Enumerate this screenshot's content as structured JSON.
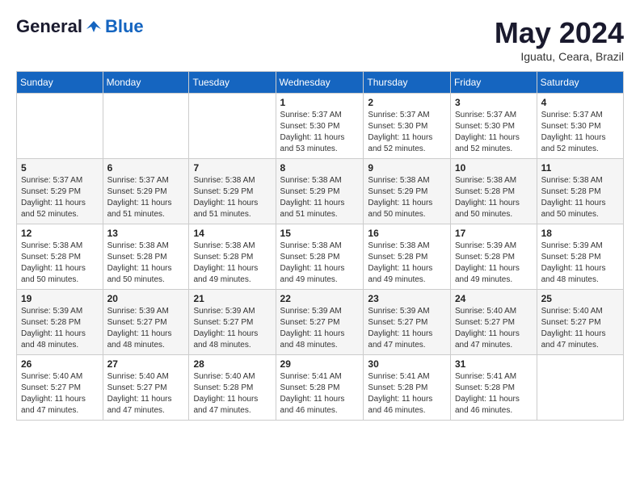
{
  "header": {
    "logo_general": "General",
    "logo_blue": "Blue",
    "month_title": "May 2024",
    "location": "Iguatu, Ceara, Brazil"
  },
  "days_of_week": [
    "Sunday",
    "Monday",
    "Tuesday",
    "Wednesday",
    "Thursday",
    "Friday",
    "Saturday"
  ],
  "weeks": [
    [
      {
        "day": "",
        "info": ""
      },
      {
        "day": "",
        "info": ""
      },
      {
        "day": "",
        "info": ""
      },
      {
        "day": "1",
        "info": "Sunrise: 5:37 AM\nSunset: 5:30 PM\nDaylight: 11 hours\nand 53 minutes."
      },
      {
        "day": "2",
        "info": "Sunrise: 5:37 AM\nSunset: 5:30 PM\nDaylight: 11 hours\nand 52 minutes."
      },
      {
        "day": "3",
        "info": "Sunrise: 5:37 AM\nSunset: 5:30 PM\nDaylight: 11 hours\nand 52 minutes."
      },
      {
        "day": "4",
        "info": "Sunrise: 5:37 AM\nSunset: 5:30 PM\nDaylight: 11 hours\nand 52 minutes."
      }
    ],
    [
      {
        "day": "5",
        "info": "Sunrise: 5:37 AM\nSunset: 5:29 PM\nDaylight: 11 hours\nand 52 minutes."
      },
      {
        "day": "6",
        "info": "Sunrise: 5:37 AM\nSunset: 5:29 PM\nDaylight: 11 hours\nand 51 minutes."
      },
      {
        "day": "7",
        "info": "Sunrise: 5:38 AM\nSunset: 5:29 PM\nDaylight: 11 hours\nand 51 minutes."
      },
      {
        "day": "8",
        "info": "Sunrise: 5:38 AM\nSunset: 5:29 PM\nDaylight: 11 hours\nand 51 minutes."
      },
      {
        "day": "9",
        "info": "Sunrise: 5:38 AM\nSunset: 5:29 PM\nDaylight: 11 hours\nand 50 minutes."
      },
      {
        "day": "10",
        "info": "Sunrise: 5:38 AM\nSunset: 5:28 PM\nDaylight: 11 hours\nand 50 minutes."
      },
      {
        "day": "11",
        "info": "Sunrise: 5:38 AM\nSunset: 5:28 PM\nDaylight: 11 hours\nand 50 minutes."
      }
    ],
    [
      {
        "day": "12",
        "info": "Sunrise: 5:38 AM\nSunset: 5:28 PM\nDaylight: 11 hours\nand 50 minutes."
      },
      {
        "day": "13",
        "info": "Sunrise: 5:38 AM\nSunset: 5:28 PM\nDaylight: 11 hours\nand 50 minutes."
      },
      {
        "day": "14",
        "info": "Sunrise: 5:38 AM\nSunset: 5:28 PM\nDaylight: 11 hours\nand 49 minutes."
      },
      {
        "day": "15",
        "info": "Sunrise: 5:38 AM\nSunset: 5:28 PM\nDaylight: 11 hours\nand 49 minutes."
      },
      {
        "day": "16",
        "info": "Sunrise: 5:38 AM\nSunset: 5:28 PM\nDaylight: 11 hours\nand 49 minutes."
      },
      {
        "day": "17",
        "info": "Sunrise: 5:39 AM\nSunset: 5:28 PM\nDaylight: 11 hours\nand 49 minutes."
      },
      {
        "day": "18",
        "info": "Sunrise: 5:39 AM\nSunset: 5:28 PM\nDaylight: 11 hours\nand 48 minutes."
      }
    ],
    [
      {
        "day": "19",
        "info": "Sunrise: 5:39 AM\nSunset: 5:28 PM\nDaylight: 11 hours\nand 48 minutes."
      },
      {
        "day": "20",
        "info": "Sunrise: 5:39 AM\nSunset: 5:27 PM\nDaylight: 11 hours\nand 48 minutes."
      },
      {
        "day": "21",
        "info": "Sunrise: 5:39 AM\nSunset: 5:27 PM\nDaylight: 11 hours\nand 48 minutes."
      },
      {
        "day": "22",
        "info": "Sunrise: 5:39 AM\nSunset: 5:27 PM\nDaylight: 11 hours\nand 48 minutes."
      },
      {
        "day": "23",
        "info": "Sunrise: 5:39 AM\nSunset: 5:27 PM\nDaylight: 11 hours\nand 47 minutes."
      },
      {
        "day": "24",
        "info": "Sunrise: 5:40 AM\nSunset: 5:27 PM\nDaylight: 11 hours\nand 47 minutes."
      },
      {
        "day": "25",
        "info": "Sunrise: 5:40 AM\nSunset: 5:27 PM\nDaylight: 11 hours\nand 47 minutes."
      }
    ],
    [
      {
        "day": "26",
        "info": "Sunrise: 5:40 AM\nSunset: 5:27 PM\nDaylight: 11 hours\nand 47 minutes."
      },
      {
        "day": "27",
        "info": "Sunrise: 5:40 AM\nSunset: 5:27 PM\nDaylight: 11 hours\nand 47 minutes."
      },
      {
        "day": "28",
        "info": "Sunrise: 5:40 AM\nSunset: 5:28 PM\nDaylight: 11 hours\nand 47 minutes."
      },
      {
        "day": "29",
        "info": "Sunrise: 5:41 AM\nSunset: 5:28 PM\nDaylight: 11 hours\nand 46 minutes."
      },
      {
        "day": "30",
        "info": "Sunrise: 5:41 AM\nSunset: 5:28 PM\nDaylight: 11 hours\nand 46 minutes."
      },
      {
        "day": "31",
        "info": "Sunrise: 5:41 AM\nSunset: 5:28 PM\nDaylight: 11 hours\nand 46 minutes."
      },
      {
        "day": "",
        "info": ""
      }
    ]
  ]
}
